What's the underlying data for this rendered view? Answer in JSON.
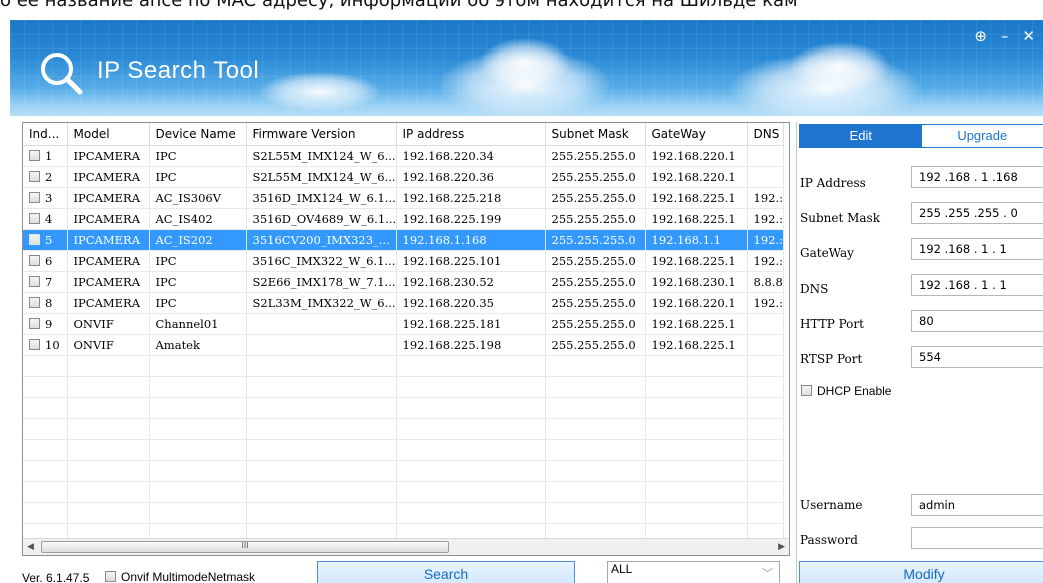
{
  "top_strip": {
    "text": "о ее название ähce no MAC адресу, информации об этом находится на Шильде кам"
  },
  "window": {
    "title": "IP Search Tool",
    "controls": {
      "pin": "⊕",
      "minimize": "–",
      "close": "✕"
    }
  },
  "table": {
    "columns": [
      "Ind...",
      "Model",
      "Device Name",
      "Firmware Version",
      "IP address",
      "Subnet Mask",
      "GateWay",
      "DNS"
    ],
    "rows": [
      {
        "index": "1",
        "model": "IPCAMERA",
        "name": "IPC",
        "firmware": "S2L55M_IMX124_W_6....",
        "ip": "192.168.220.34",
        "mask": "255.255.255.0",
        "gateway": "192.168.220.1",
        "dns": ""
      },
      {
        "index": "2",
        "model": "IPCAMERA",
        "name": "IPC",
        "firmware": "S2L55M_IMX124_W_6....",
        "ip": "192.168.220.36",
        "mask": "255.255.255.0",
        "gateway": "192.168.220.1",
        "dns": ""
      },
      {
        "index": "3",
        "model": "IPCAMERA",
        "name": "AC_IS306V",
        "firmware": "3516D_IMX124_W_6.1....",
        "ip": "192.168.225.218",
        "mask": "255.255.255.0",
        "gateway": "192.168.225.1",
        "dns": "192.:"
      },
      {
        "index": "4",
        "model": "IPCAMERA",
        "name": "AC_IS402",
        "firmware": "3516D_OV4689_W_6.1....",
        "ip": "192.168.225.199",
        "mask": "255.255.255.0",
        "gateway": "192.168.225.1",
        "dns": "192.:"
      },
      {
        "index": "5",
        "model": "IPCAMERA",
        "name": "AC_IS202",
        "firmware": "3516CV200_IMX323_...",
        "ip": "192.168.1.168",
        "mask": "255.255.255.0",
        "gateway": "192.168.1.1",
        "dns": "192.:"
      },
      {
        "index": "6",
        "model": "IPCAMERA",
        "name": "IPC",
        "firmware": "3516C_IMX322_W_6.1....",
        "ip": "192.168.225.101",
        "mask": "255.255.255.0",
        "gateway": "192.168.225.1",
        "dns": "192.:"
      },
      {
        "index": "7",
        "model": "IPCAMERA",
        "name": "IPC",
        "firmware": "S2E66_IMX178_W_7.1....",
        "ip": "192.168.230.52",
        "mask": "255.255.255.0",
        "gateway": "192.168.230.1",
        "dns": "8.8.8"
      },
      {
        "index": "8",
        "model": "IPCAMERA",
        "name": "IPC",
        "firmware": "S2L33M_IMX322_W_6....",
        "ip": "192.168.220.35",
        "mask": "255.255.255.0",
        "gateway": "192.168.220.1",
        "dns": "192.:"
      },
      {
        "index": "9",
        "model": "ONVIF",
        "name": "Channel01",
        "firmware": "",
        "ip": "192.168.225.181",
        "mask": "255.255.255.0",
        "gateway": "192.168.225.1",
        "dns": ""
      },
      {
        "index": "10",
        "model": "ONVIF",
        "name": "Amatek",
        "firmware": "",
        "ip": "192.168.225.198",
        "mask": "255.255.255.0",
        "gateway": "192.168.225.1",
        "dns": ""
      }
    ],
    "selected_index": "5",
    "scroll_grip": "III"
  },
  "bottom": {
    "version": "Ver. 6.1.47.5",
    "onvif_label": "Onvif MultimodeNetmask",
    "search_label": "Search",
    "filter_value": "ALL"
  },
  "edit_panel": {
    "tab_edit": "Edit",
    "tab_upgrade": "Upgrade",
    "fields": {
      "ip_label": "IP Address",
      "ip_value": "192 .168 . 1 .168",
      "mask_label": "Subnet Mask",
      "mask_value": "255 .255 .255 . 0",
      "gateway_label": "GateWay",
      "gateway_value": "192 .168 . 1 . 1",
      "dns_label": "DNS",
      "dns_value": "192 .168 . 1 . 1",
      "http_label": "HTTP Port",
      "http_value": "80",
      "rtsp_label": "RTSP Port",
      "rtsp_value": "554",
      "dhcp_label": "DHCP Enable",
      "username_label": "Username",
      "username_value": "admin",
      "password_label": "Password",
      "password_value": ""
    },
    "modify_label": "Modify"
  }
}
